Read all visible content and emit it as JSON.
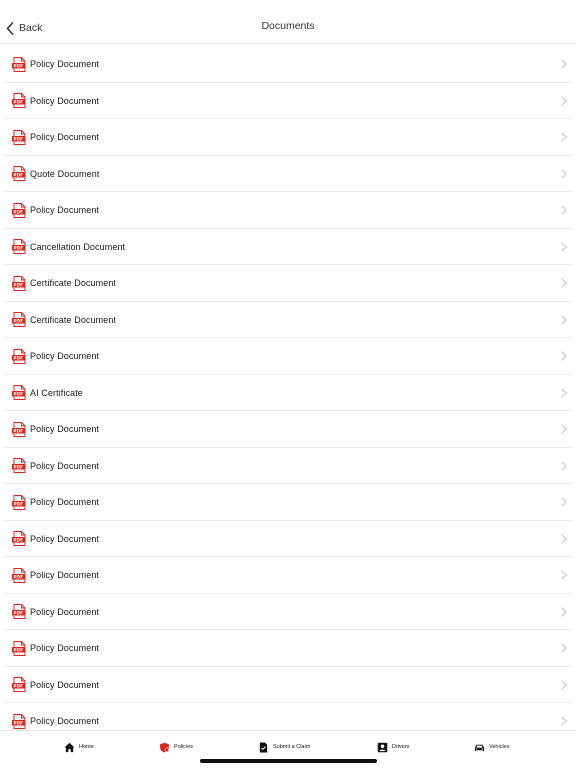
{
  "header": {
    "back_label": "Back",
    "title": "Documents"
  },
  "documents": [
    {
      "label": "Policy Document",
      "icon": "pdf-icon"
    },
    {
      "label": "Policy Document",
      "icon": "pdf-icon"
    },
    {
      "label": "Policy Document",
      "icon": "pdf-icon"
    },
    {
      "label": "Quote Document",
      "icon": "pdf-icon"
    },
    {
      "label": "Policy Document",
      "icon": "pdf-icon"
    },
    {
      "label": "Cancellation Document",
      "icon": "pdf-icon"
    },
    {
      "label": "Certificate Document",
      "icon": "pdf-icon"
    },
    {
      "label": "Certificate Document",
      "icon": "pdf-icon"
    },
    {
      "label": "Policy Document",
      "icon": "pdf-icon"
    },
    {
      "label": "AI Certificate",
      "icon": "pdf-icon"
    },
    {
      "label": "Policy Document",
      "icon": "pdf-icon"
    },
    {
      "label": "Policy Document",
      "icon": "pdf-icon"
    },
    {
      "label": "Policy Document",
      "icon": "pdf-icon"
    },
    {
      "label": "Policy Document",
      "icon": "pdf-icon"
    },
    {
      "label": "Policy Document",
      "icon": "pdf-icon"
    },
    {
      "label": "Policy Document",
      "icon": "pdf-icon"
    },
    {
      "label": "Policy Document",
      "icon": "pdf-icon"
    },
    {
      "label": "Policy Document",
      "icon": "pdf-icon"
    },
    {
      "label": "Policy Document",
      "icon": "pdf-icon"
    }
  ],
  "pdf_icon_text": "PDF",
  "tabbar": {
    "home": "Home",
    "policies": "Policies",
    "claim": "Submit a Claim",
    "drivers": "Drivers",
    "vehicles": "Vehicles"
  },
  "colors": {
    "pdf_red": "#d9261c",
    "policies_icon": "#d9261c",
    "separator": "#e8e8e8",
    "chevron": "#c4c4c4"
  }
}
